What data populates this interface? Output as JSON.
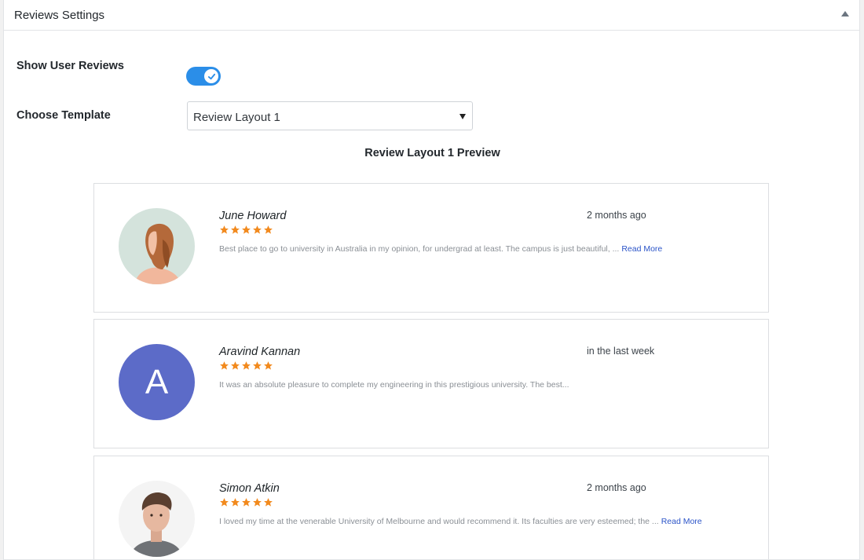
{
  "panel": {
    "title": "Reviews Settings"
  },
  "settings": {
    "show_reviews_label": "Show User Reviews",
    "show_reviews_enabled": true,
    "choose_template_label": "Choose Template",
    "template_value": "Review Layout 1"
  },
  "preview": {
    "title": "Review Layout 1 Preview",
    "reviews": [
      {
        "name": "June Howard",
        "date": "2 months ago",
        "rating": 5,
        "text": "Best place to go to university in Australia in my opinion, for undergrad at least. The campus is just beautiful, ...",
        "read_more": "Read More",
        "avatar": "photo-woman"
      },
      {
        "name": "Aravind Kannan",
        "date": "in the last week",
        "rating": 5,
        "text": "It was an absolute pleasure to complete my engineering in this prestigious university. The best...",
        "read_more": "",
        "avatar_letter": "A"
      },
      {
        "name": "Simon Atkin",
        "date": "2 months ago",
        "rating": 5,
        "text": "I loved my time at the venerable University of Melbourne and would recommend it. Its faculties are very esteemed; the ...",
        "read_more": "Read More",
        "avatar": "photo-man"
      }
    ]
  },
  "colors": {
    "toggle_on": "#2b8ee8",
    "star": "#f28a1e",
    "link": "#2b54c8",
    "avatar_letter_bg": "#5c6bc8"
  }
}
